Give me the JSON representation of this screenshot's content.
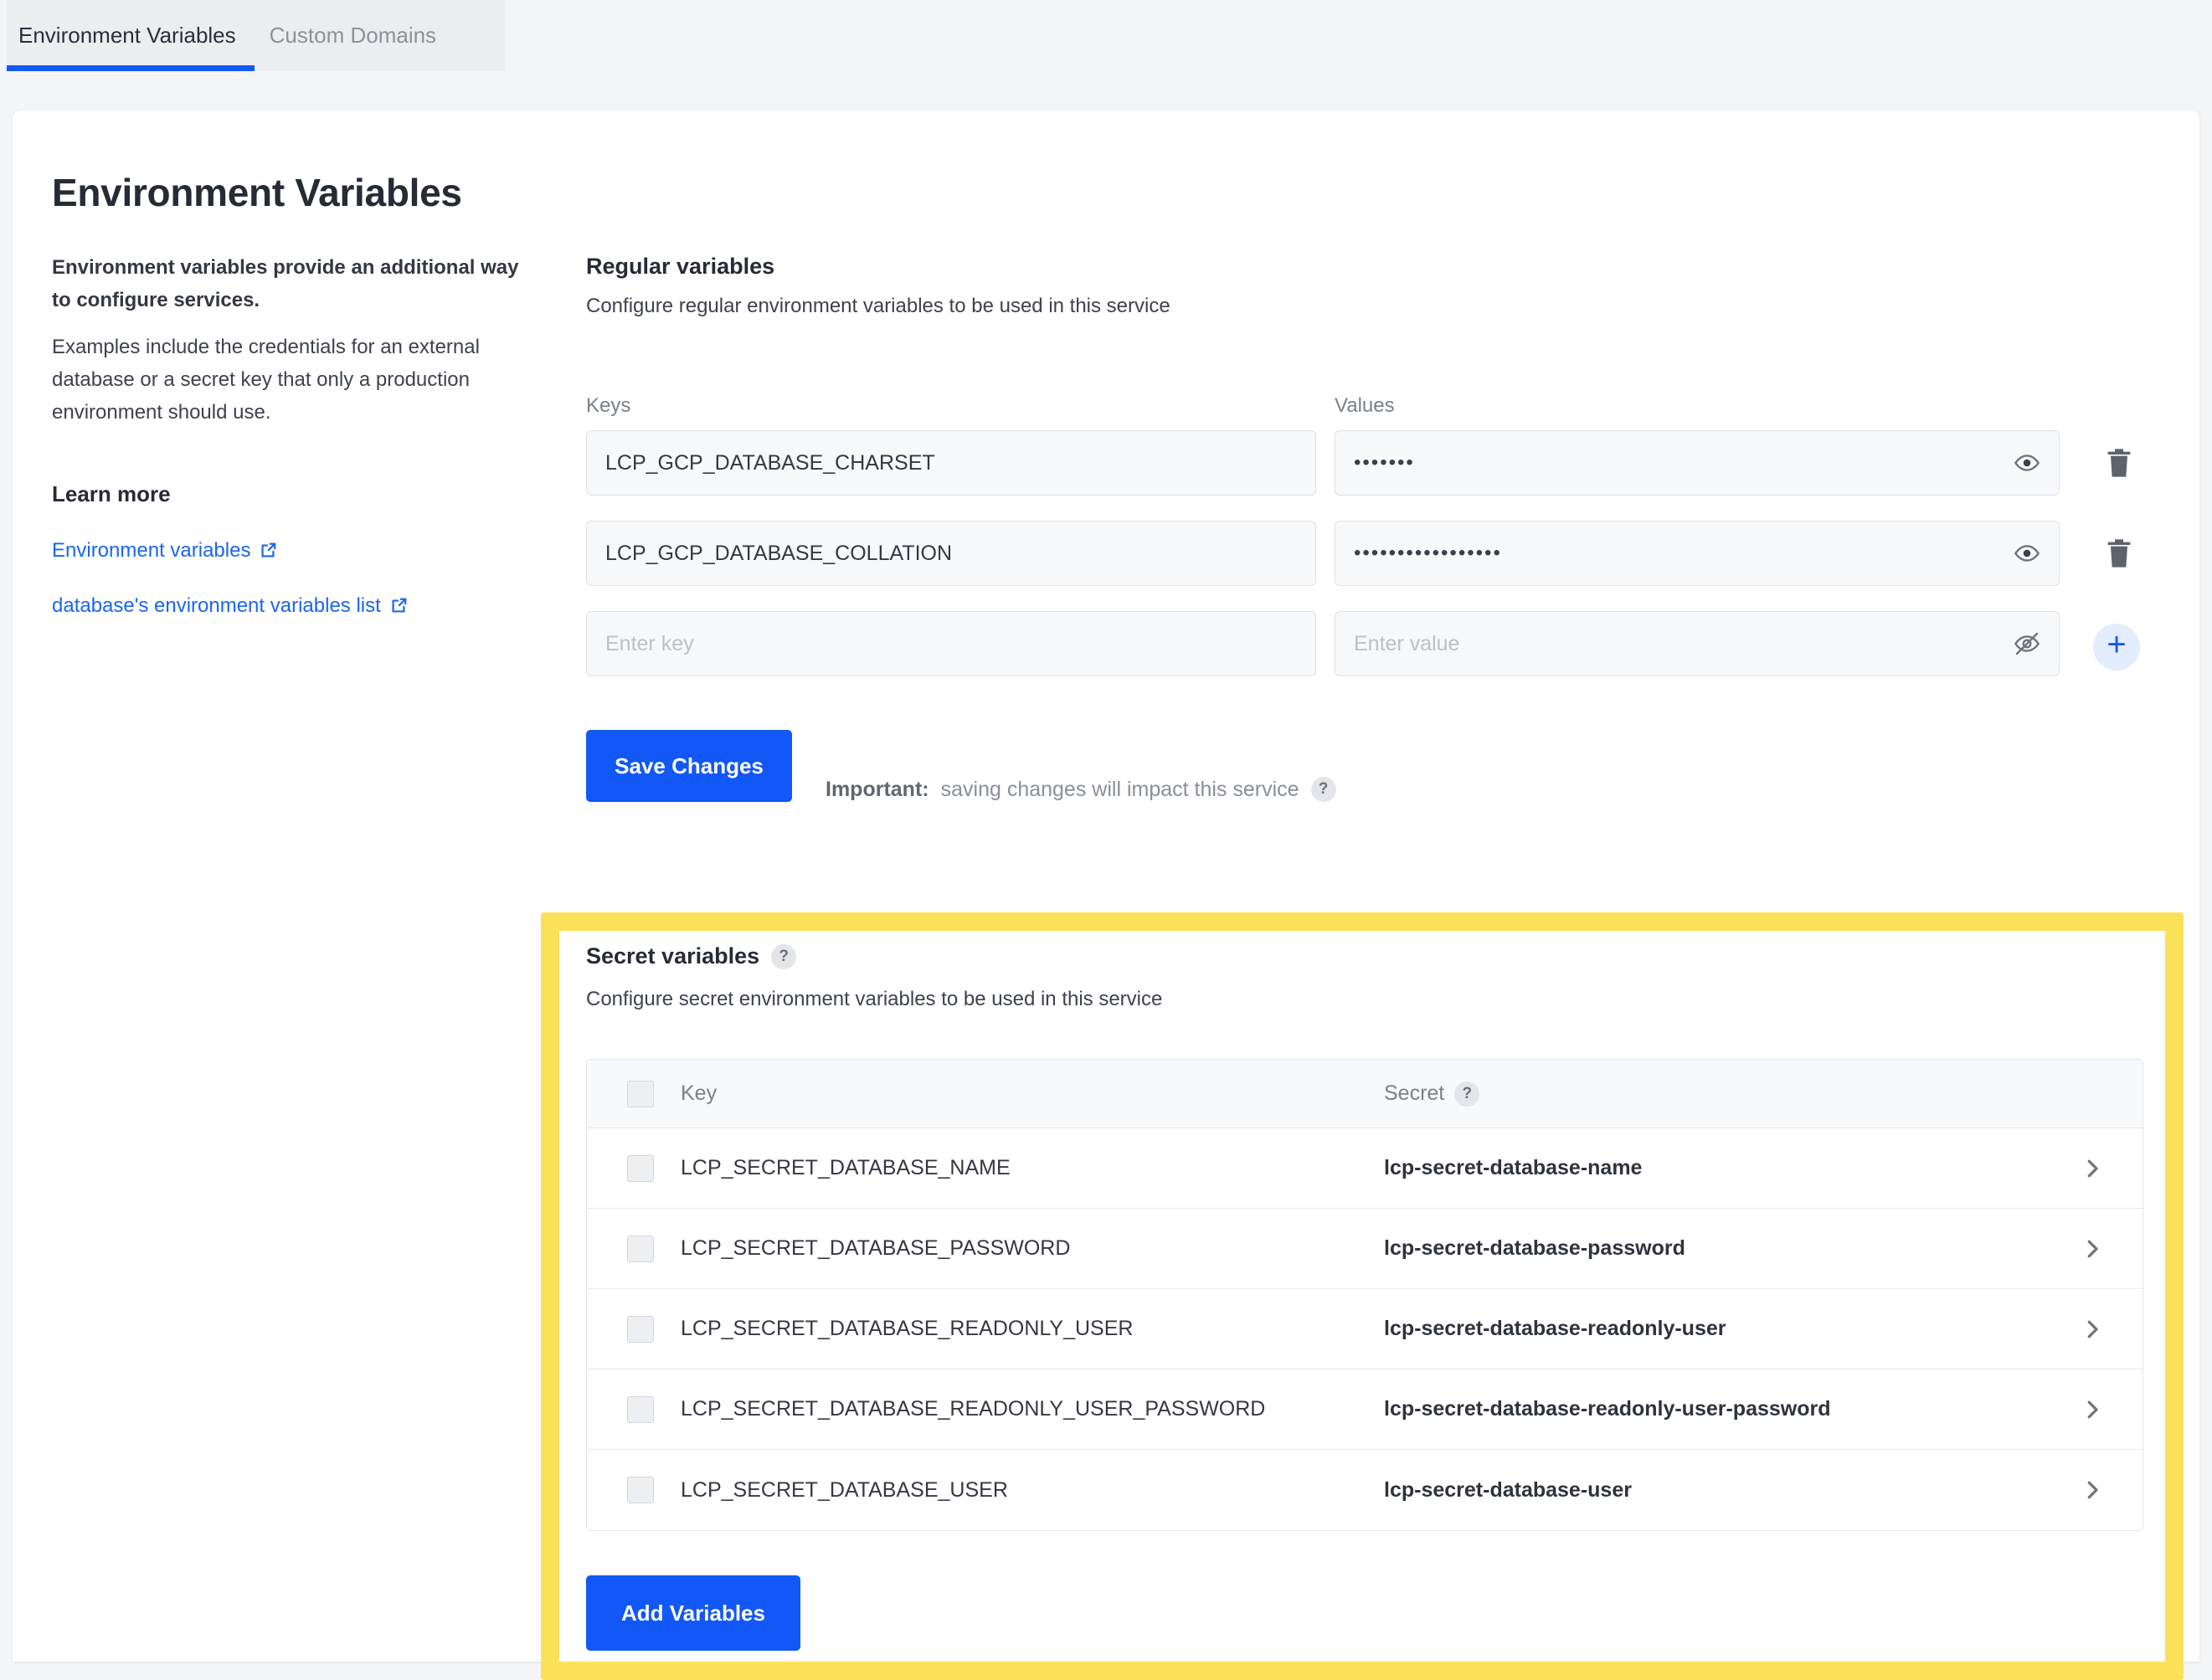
{
  "tabs": [
    {
      "label": "Environment Variables",
      "active": true
    },
    {
      "label": "Custom Domains",
      "active": false
    }
  ],
  "page_title": "Environment Variables",
  "info": {
    "lead": "Environment variables provide an additional way to configure services.",
    "body": "Examples include the credentials for an external database or a secret key that only a production environment should use.",
    "learn_more_title": "Learn more",
    "links": [
      {
        "label": "Environment variables",
        "icon": "external-link-icon"
      },
      {
        "label": "database's environment variables list",
        "icon": "external-link-icon"
      }
    ]
  },
  "regular": {
    "heading": "Regular variables",
    "subheading": "Configure regular environment variables to be used in this service",
    "keys_label": "Keys",
    "values_label": "Values",
    "rows": [
      {
        "key": "LCP_GCP_DATABASE_CHARSET",
        "value_masked": "•••••••",
        "value_visible": false,
        "eye_icon": "eye-icon",
        "delete_icon": "trash-icon"
      },
      {
        "key": "LCP_GCP_DATABASE_COLLATION",
        "value_masked": "•••••••••••••••••",
        "value_visible": false,
        "eye_icon": "eye-icon",
        "delete_icon": "trash-icon"
      }
    ],
    "new_row": {
      "key_placeholder": "Enter key",
      "value_placeholder": "Enter value",
      "eye_icon": "eye-off-icon",
      "add_icon": "plus-icon"
    },
    "save_label": "Save Changes",
    "important_label": "Important:",
    "important_text": "saving changes will impact this service",
    "important_help_icon": "question-mark-icon"
  },
  "secret": {
    "heading": "Secret variables",
    "heading_help_icon": "question-mark-icon",
    "subheading": "Configure secret environment variables to be used in this service",
    "columns": {
      "select_all": "",
      "key": "Key",
      "secret": "Secret",
      "secret_help_icon": "question-mark-icon"
    },
    "rows": [
      {
        "key": "LCP_SECRET_DATABASE_NAME",
        "secret": "lcp-secret-database-name",
        "chevron": "›"
      },
      {
        "key": "LCP_SECRET_DATABASE_PASSWORD",
        "secret": "lcp-secret-database-password",
        "chevron": "›"
      },
      {
        "key": "LCP_SECRET_DATABASE_READONLY_USER",
        "secret": "lcp-secret-database-readonly-user",
        "chevron": "›"
      },
      {
        "key": "LCP_SECRET_DATABASE_READONLY_USER_PASSWORD",
        "secret": "lcp-secret-database-readonly-user-password",
        "chevron": "›"
      },
      {
        "key": "LCP_SECRET_DATABASE_USER",
        "secret": "lcp-secret-database-user",
        "chevron": "›"
      }
    ],
    "add_label": "Add Variables"
  },
  "colors": {
    "accent_blue": "#1158f7",
    "highlight_yellow": "#fbe158",
    "link_blue": "#1a66ef",
    "page_bg": "#f4f5f7",
    "tabbar_bg": "#ecedef"
  }
}
